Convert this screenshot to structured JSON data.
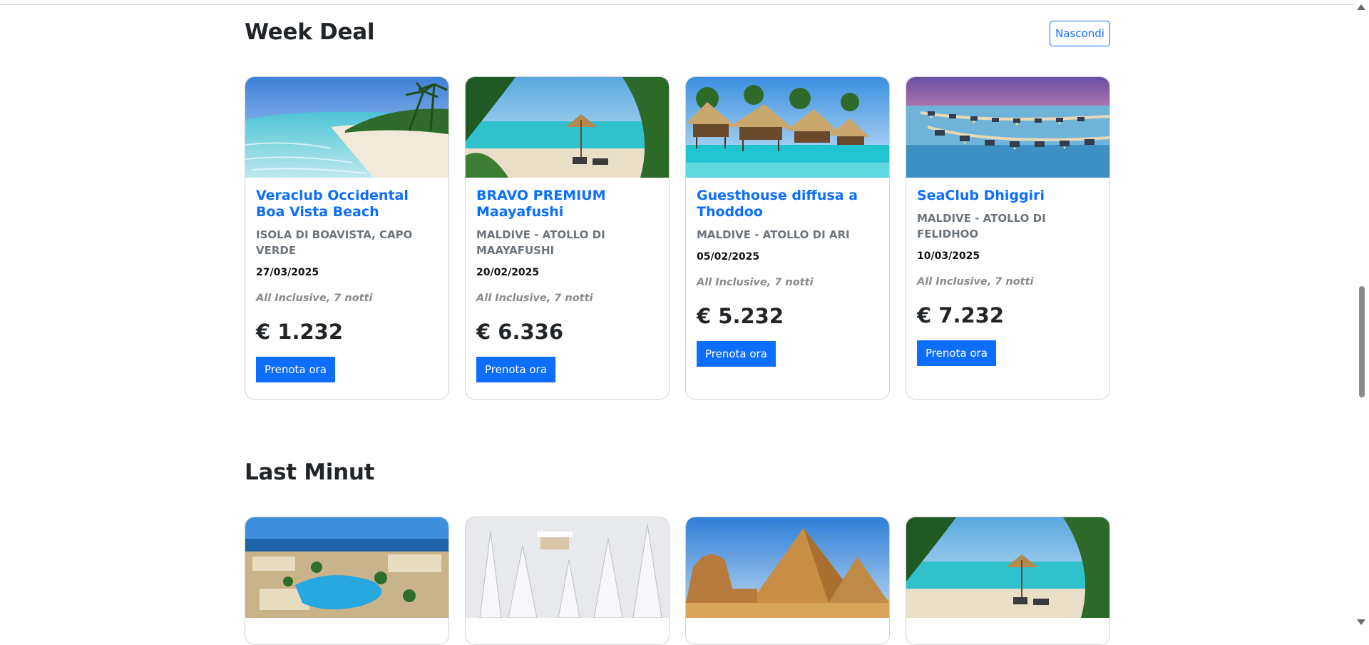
{
  "week_deal": {
    "title": "Week Deal",
    "hide_label": "Nascondi",
    "cards": [
      {
        "title": "Veraclub Occidental Boa Vista Beach",
        "location": "ISOLA DI BOAVISTA, CAPO VERDE",
        "date": "27/03/2025",
        "description": "All Inclusive, 7 notti",
        "price": "€ 1.232",
        "button": "Prenota ora",
        "image": "tropical-beach-image"
      },
      {
        "title": "BRAVO PREMIUM Maayafushi",
        "location": "MALDIVE - ATOLLO DI MAAYAFUSHI",
        "date": "20/02/2025",
        "description": "All Inclusive, 7 notti",
        "price": "€ 6.336",
        "button": "Prenota ora",
        "image": "beach-umbrella-image"
      },
      {
        "title": "Guesthouse diffusa a Thoddoo",
        "location": "MALDIVE - ATOLLO DI ARI",
        "date": "05/02/2025",
        "description": "All Inclusive, 7 notti",
        "price": "€ 5.232",
        "button": "Prenota ora",
        "image": "water-bungalows-image"
      },
      {
        "title": "SeaClub Dhiggiri",
        "location": "MALDIVE - ATOLLO DI FELIDHOO",
        "date": "10/03/2025",
        "description": "All Inclusive, 7 notti",
        "price": "€ 7.232",
        "button": "Prenota ora",
        "image": "overwater-villas-image"
      }
    ]
  },
  "last_minute": {
    "title": "Last Minut",
    "cards": [
      {
        "image": "resort-pool-image"
      },
      {
        "image": "snowy-forest-image"
      },
      {
        "image": "pyramids-image"
      },
      {
        "image": "beach-umbrella-image"
      }
    ]
  },
  "colors": {
    "accent": "#0d6efd",
    "muted": "#6c757d",
    "text": "#212529"
  }
}
